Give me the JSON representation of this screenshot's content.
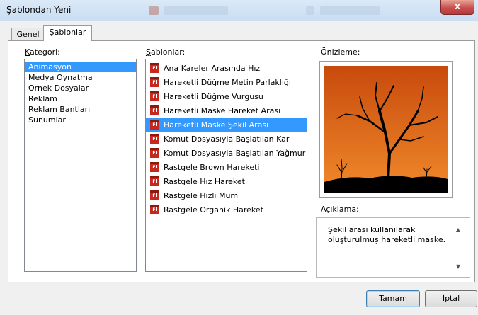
{
  "window": {
    "title": "Şablondan Yeni",
    "close_glyph": "x"
  },
  "tabs": [
    {
      "label": "Genel",
      "active": false
    },
    {
      "label": "Şablonlar",
      "active": true
    }
  ],
  "category": {
    "label_first": "K",
    "label_rest": "ategori:",
    "items": [
      "Animasyon",
      "Medya Oynatma",
      "Örnek Dosyalar",
      "Reklam",
      "Reklam Bantları",
      "Sunumlar"
    ],
    "selected_index": 0
  },
  "templates": {
    "label_first": "Ş",
    "label_rest": "ablonlar:",
    "icon": "flash-file-icon",
    "icon_text": "Fl",
    "items": [
      "Ana Kareler Arasında Hız",
      "Hareketli Düğme Metin Parlaklığı",
      "Hareketli Düğme Vurgusu",
      "Hareketli Maske Hareket Arası",
      "Hareketli Maske Şekil Arası",
      "Komut Dosyasıyla Başlatılan Kar",
      "Komut Dosyasıyla Başlatılan Yağmur",
      "Rastgele Brown Hareketi",
      "Rastgele Hız Hareketi",
      "Rastgele Hızlı Mum",
      "Rastgele Organik Hareket"
    ],
    "selected_index": 4
  },
  "preview": {
    "label": "Önizleme:",
    "colors": {
      "sky_top": "#c84a0c",
      "sky_bottom": "#f08a2c",
      "ground": "#000000"
    }
  },
  "description": {
    "label": "Açıklama:",
    "text": "Şekil arası kullanılarak oluşturulmuş hareketli maske."
  },
  "buttons": {
    "ok": "Tamam",
    "cancel_first": "İ",
    "cancel_rest": "ptal"
  },
  "colors": {
    "selection": "#3399ff",
    "icon_red": "#c6281e"
  }
}
